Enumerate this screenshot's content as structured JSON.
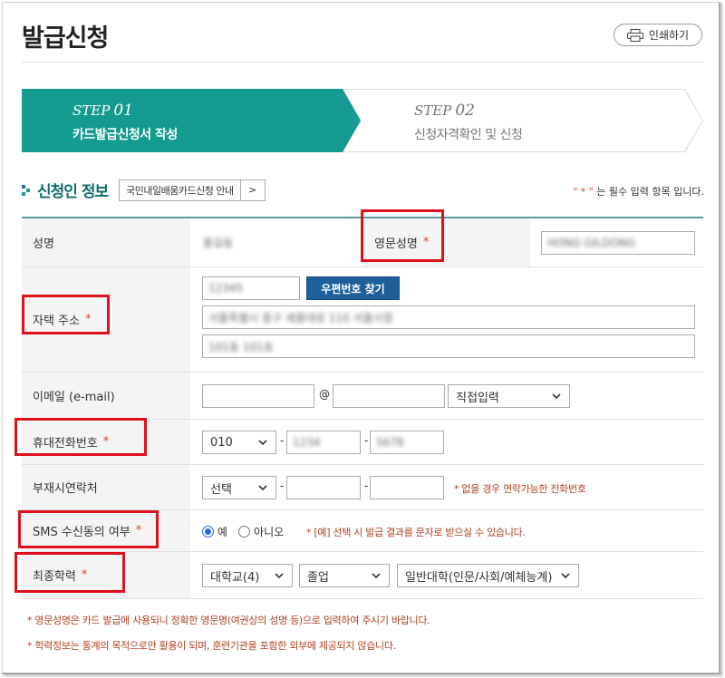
{
  "page": {
    "title": "발급신청",
    "print_label": "인쇄하기"
  },
  "steps": [
    {
      "no": "STEP",
      "num": "01",
      "label": "카드발급신청서 작성",
      "active": true
    },
    {
      "no": "STEP",
      "num": "02",
      "label": "신청자격확인 및 신청",
      "active": false
    }
  ],
  "section": {
    "title": "신청인 정보",
    "guide_label": "국민내일배움카드신청 안내",
    "guide_arrow": ">",
    "required_note_star": "\" * \"",
    "required_note_text": " 는 필수 입력 항목 입니다."
  },
  "fields": {
    "name": {
      "label": "성명",
      "value": "홍길동"
    },
    "eng_name": {
      "label": "영문성명",
      "required": "*",
      "value": "HONG GILDONG"
    },
    "address": {
      "label": "자택 주소",
      "required": "*",
      "zip": "12345",
      "zip_button": "우편번호 찾기",
      "line1": "서울특별시 중구 세종대로 110 서울시청",
      "line2": "101동 101호"
    },
    "email": {
      "label": "이메일 (e-mail)",
      "at": "@",
      "domain_select": "직접입력"
    },
    "mobile": {
      "label": "휴대전화번호",
      "required": "*",
      "prefix": "010",
      "dash": "-",
      "mid": "1234",
      "last": "5678"
    },
    "alt_phone": {
      "label": "부재시연락처",
      "prefix": "선택",
      "dash": "-",
      "note": "* 없을 경우 연락가능한 전화번호"
    },
    "sms": {
      "label": "SMS 수신동의 여부",
      "required": "*",
      "yes": "예",
      "no": "아니오",
      "note": "* [예] 선택 시 발급 결과를 문자로 받으실 수 있습니다."
    },
    "education": {
      "label": "최종학력",
      "required": "*",
      "level": "대학교(4)",
      "status": "졸업",
      "type": "일반대학(인문/사회/예체능계)"
    }
  },
  "footnotes": [
    "* 영문성명은 카드 발급에 사용되니 정확한 영문명(여권상의 성명 등)으로 입력하여 주시기 바랍니다.",
    "* 학력정보는 통계의 목적으로만 활용이 되며, 훈련기관을 포함한 외부에 제공되지 않습니다."
  ],
  "colors": {
    "accent": "#149b91",
    "title_teal": "#0e6d6a",
    "required": "#d14a20",
    "button_blue": "#1d5f9b",
    "highlight": "#e0101a"
  }
}
